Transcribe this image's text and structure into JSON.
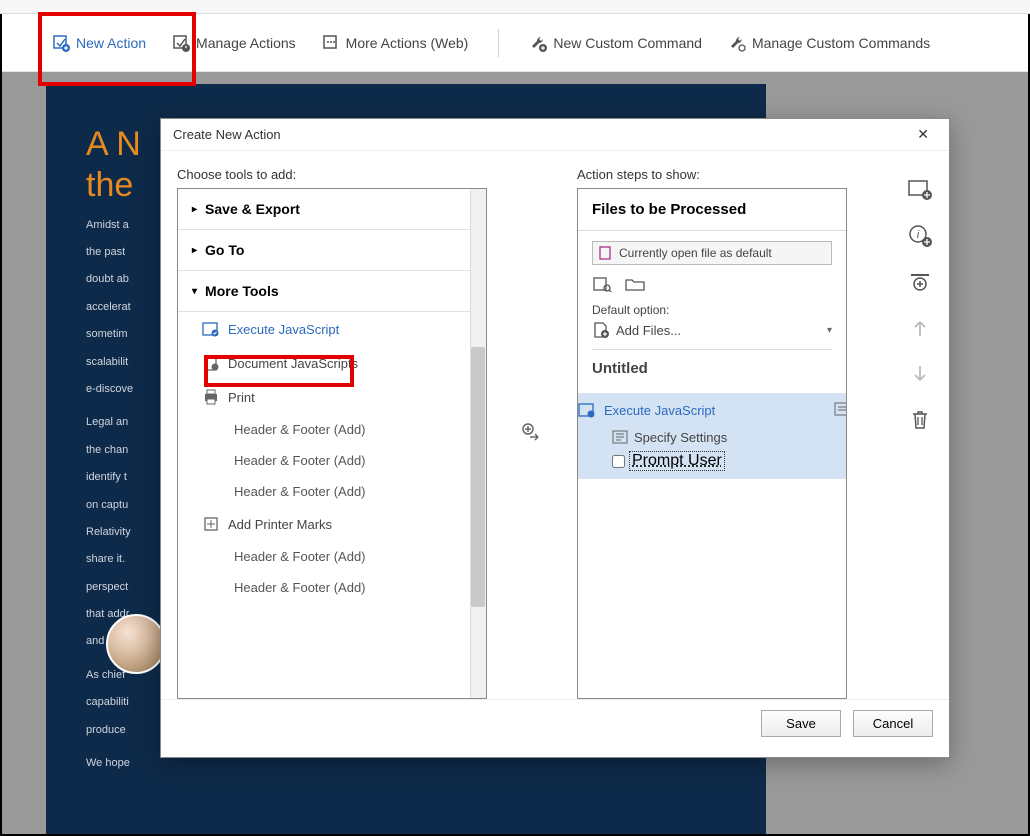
{
  "toolbar": {
    "new_action": "New Action",
    "manage_actions": "Manage Actions",
    "more_actions": "More Actions (Web)",
    "new_custom_cmd": "New Custom Command",
    "manage_custom_cmds": "Manage Custom Commands"
  },
  "doc": {
    "title_line1": "A N",
    "title_line2": "the",
    "p1": "Amidst a",
    "p2": "the past",
    "p3": "doubt ab",
    "p4": "accelerat",
    "p5": "sometim",
    "p6": "scalabilit",
    "p7": "e-discove",
    "p8": "Legal an",
    "p9": "the chan",
    "p10": "identify t",
    "p11": "on captu",
    "p12": "Relativity",
    "p13": "share it.",
    "p14": "perspect",
    "p15": "that addr",
    "p16": "and e-dis",
    "p17": "As chief",
    "p18": "capabiliti",
    "p19": "produce",
    "p20": "We hope"
  },
  "dialog": {
    "title": "Create New Action",
    "choose_label": "Choose tools to add:",
    "steps_label": "Action steps to show:",
    "cats": {
      "save_export": "Save & Export",
      "go_to": "Go To",
      "more_tools": "More Tools"
    },
    "tools": {
      "execute_js": "Execute JavaScript",
      "doc_js": "Document JavaScripts",
      "print": "Print",
      "hf_add1": "Header & Footer (Add)",
      "hf_add2": "Header & Footer (Add)",
      "hf_add3": "Header & Footer (Add)",
      "add_marks": "Add Printer Marks",
      "hf_add4": "Header & Footer (Add)",
      "hf_add5": "Header & Footer (Add)"
    },
    "right": {
      "files_header": "Files to be Processed",
      "open_default": "Currently open file as default",
      "default_option": "Default option:",
      "add_files": "Add Files...",
      "untitled": "Untitled",
      "exec_js_step": "Execute JavaScript",
      "specify": "Specify Settings",
      "prompt": "Prompt User"
    },
    "buttons": {
      "save": "Save",
      "cancel": "Cancel"
    }
  }
}
